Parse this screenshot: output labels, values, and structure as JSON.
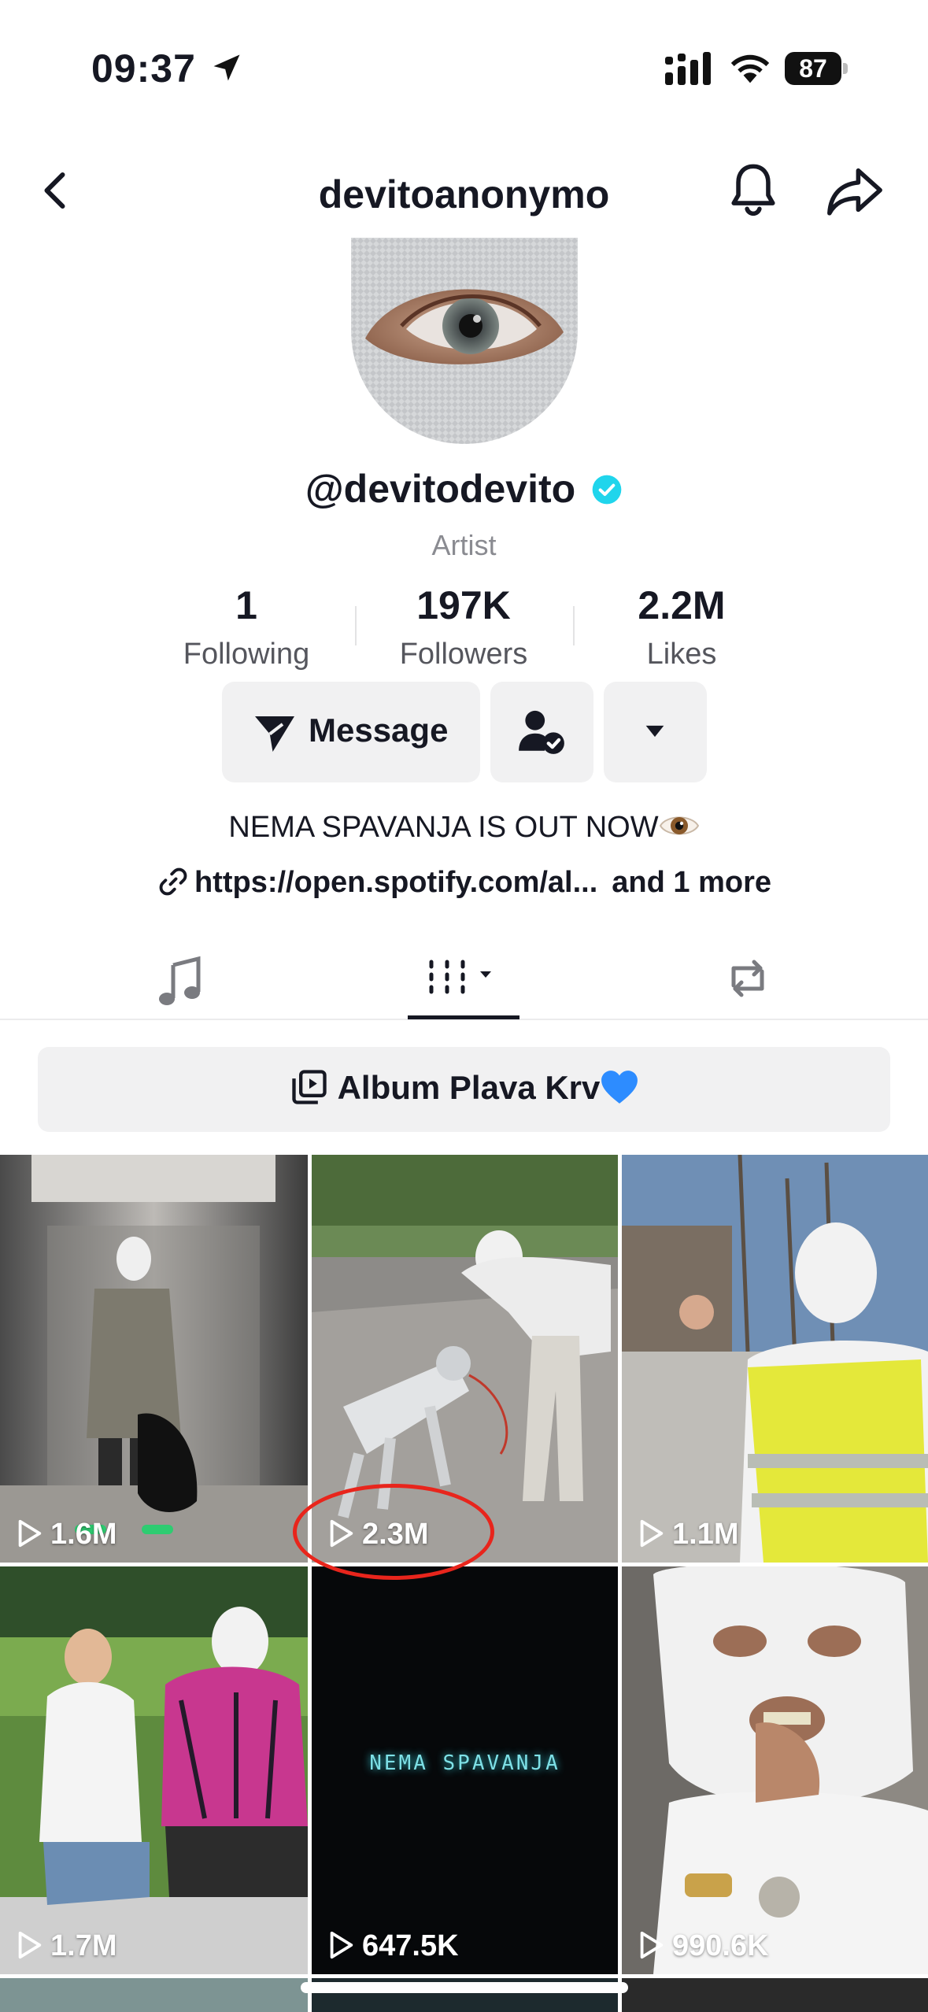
{
  "status_bar": {
    "time": "09:37",
    "battery": "87"
  },
  "header": {
    "title": "devitoanonymo"
  },
  "profile": {
    "handle": "@devitodevito",
    "role": "Artist",
    "stats": [
      {
        "value": "1",
        "label": "Following"
      },
      {
        "value": "197K",
        "label": "Followers"
      },
      {
        "value": "2.2M",
        "label": "Likes"
      }
    ],
    "message_label": "Message",
    "bio": "NEMA SPAVANJA IS OUT NOW",
    "link_text": "https://open.spotify.com/al...",
    "link_more": "and 1 more"
  },
  "playlist": {
    "label": "Album Plava Krv"
  },
  "videos": [
    {
      "views": "1.6M"
    },
    {
      "views": "2.3M"
    },
    {
      "views": "1.1M"
    },
    {
      "views": "1.7M"
    },
    {
      "views": "647.5K",
      "overlay_text": "NEMA SPAVANJA"
    },
    {
      "views": "990.6K"
    }
  ],
  "colors": {
    "verified": "#20d5ec",
    "annotation": "#e8251c",
    "button_bg": "#f1f1f2"
  }
}
